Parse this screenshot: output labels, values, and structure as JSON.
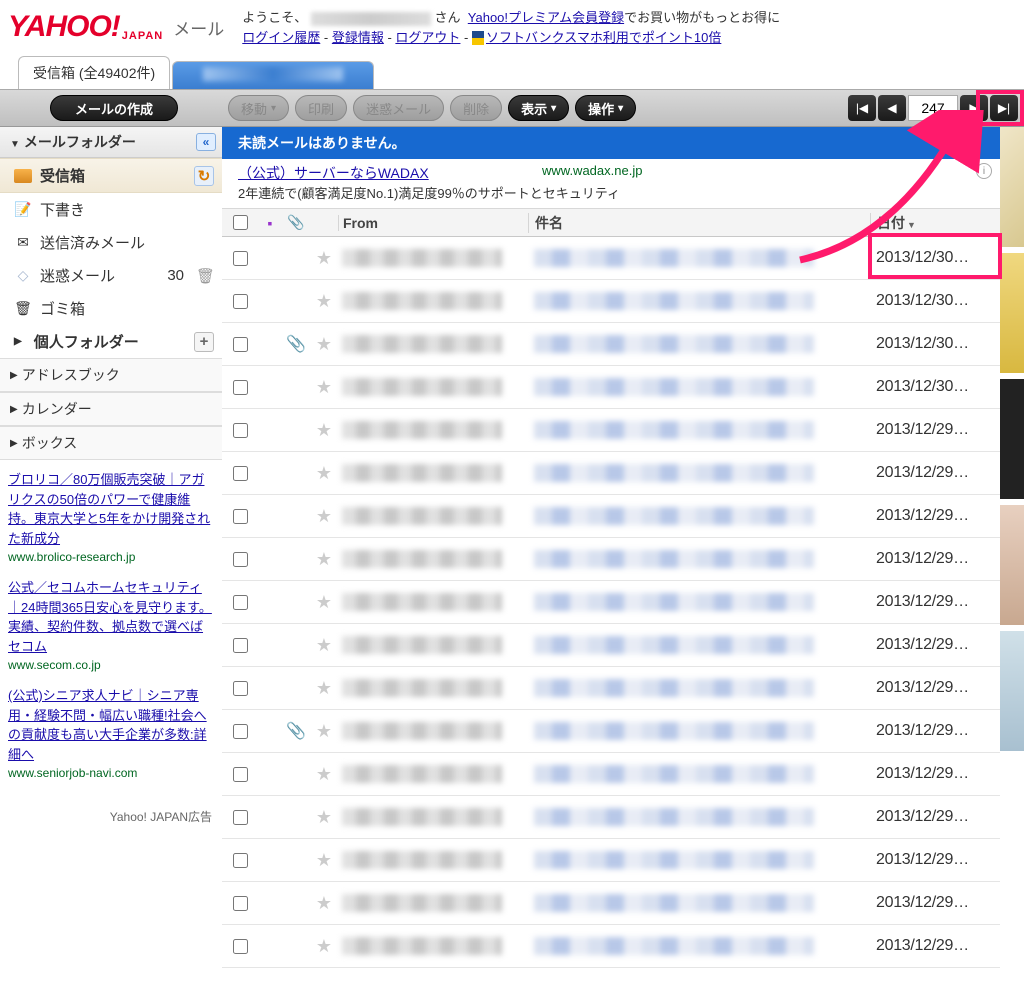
{
  "header": {
    "logo_main": "YAHOO!",
    "logo_sub": "JAPAN",
    "logo_mail": "メール",
    "welcome_prefix": "ようこそ、",
    "welcome_suffix": "さん",
    "premium_link": "Yahoo!プレミアム会員登録",
    "premium_suffix": "でお買い物がもっとお得に",
    "login_history": "ログイン履歴",
    "reg_info": "登録情報",
    "logout": "ログアウト",
    "softbank": "ソフトバンクスマホ利用でポイント10倍"
  },
  "tabs": {
    "inbox_label": "受信箱",
    "inbox_count": "(全49402件)"
  },
  "toolbar": {
    "compose": "メールの作成",
    "move": "移動",
    "print": "印刷",
    "spam": "迷惑メール",
    "delete": "削除",
    "display": "表示",
    "operation": "操作",
    "page": "247"
  },
  "sidebar": {
    "folders_header": "メールフォルダー",
    "inbox": "受信箱",
    "drafts": "下書き",
    "sent": "送信済みメール",
    "spam": "迷惑メール",
    "spam_count": "30",
    "trash": "ゴミ箱",
    "personal": "個人フォルダー",
    "address": "アドレスブック",
    "calendar": "カレンダー",
    "box": "ボックス"
  },
  "ads": [
    {
      "title": "ブロリコ／80万個販売突破｜アガリクスの50倍のパワーで健康維持。東京大学と5年をかけ開発された新成分",
      "domain": "www.brolico-research.jp"
    },
    {
      "title": "公式／セコムホームセキュリティ｜24時間365日安心を見守ります。実績、契約件数、拠点数で選べばセコム",
      "domain": "www.secom.co.jp"
    },
    {
      "title": "(公式)シニア求人ナビ｜シニア専用・経験不問・幅広い職種!社会への貢献度も高い大手企業が多数:詳細へ",
      "domain": "www.seniorjob-navi.com"
    }
  ],
  "ad_footer": "Yahoo! JAPAN広告",
  "content": {
    "unread_banner": "未読メールはありません。",
    "sponsor_title": "（公式）サーバーならWADAX",
    "sponsor_domain": "www.wadax.ne.jp",
    "sponsor_desc": "2年連続で(顧客満足度No.1)満足度99％のサポートとセキュリティ",
    "col_from": "From",
    "col_subject": "件名",
    "col_date": "日付"
  },
  "rows": [
    {
      "attach": false,
      "date": "2013/12/30…"
    },
    {
      "attach": false,
      "date": "2013/12/30…"
    },
    {
      "attach": true,
      "date": "2013/12/30…"
    },
    {
      "attach": false,
      "date": "2013/12/30…"
    },
    {
      "attach": false,
      "date": "2013/12/29…"
    },
    {
      "attach": false,
      "date": "2013/12/29…"
    },
    {
      "attach": false,
      "date": "2013/12/29…"
    },
    {
      "attach": false,
      "date": "2013/12/29…"
    },
    {
      "attach": false,
      "date": "2013/12/29…"
    },
    {
      "attach": false,
      "date": "2013/12/29…"
    },
    {
      "attach": false,
      "date": "2013/12/29…"
    },
    {
      "attach": true,
      "date": "2013/12/29…"
    },
    {
      "attach": false,
      "date": "2013/12/29…"
    },
    {
      "attach": false,
      "date": "2013/12/29…"
    },
    {
      "attach": false,
      "date": "2013/12/29…"
    },
    {
      "attach": false,
      "date": "2013/12/29…"
    },
    {
      "attach": false,
      "date": "2013/12/29…"
    }
  ]
}
